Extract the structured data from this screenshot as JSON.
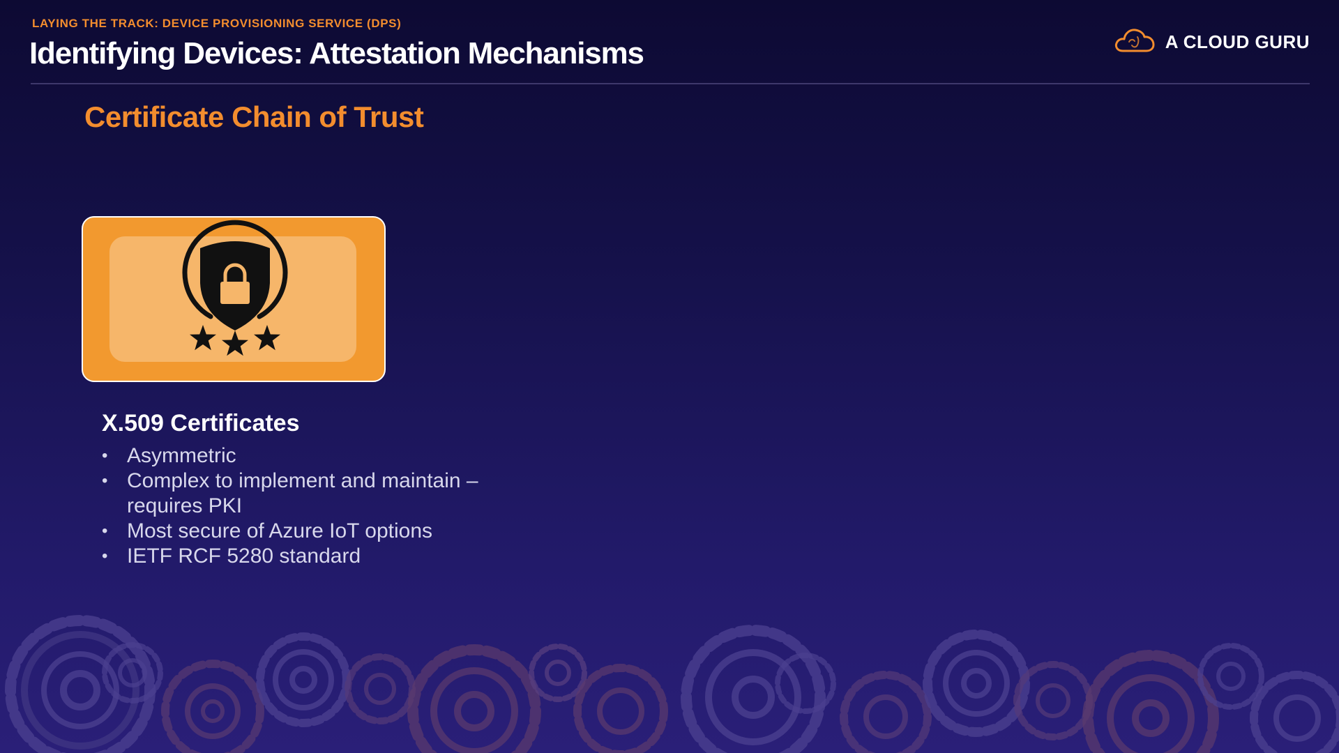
{
  "slide": {
    "eyebrow": "LAYING THE TRACK: DEVICE PROVISIONING SERVICE (DPS)",
    "title": "Identifying Devices: Attestation Mechanisms"
  },
  "brand": {
    "name": "A CLOUD GURU",
    "icon": "cloud-icon"
  },
  "section": {
    "title": "Certificate Chain of Trust"
  },
  "card": {
    "icon": "shield-lock-stars-icon"
  },
  "content": {
    "heading": "X.509 Certificates",
    "bullets": [
      "Asymmetric",
      "Complex to implement and maintain – requires PKI",
      "Most secure of Azure IoT options",
      "IETF RCF 5280 standard"
    ]
  },
  "colors": {
    "accent": "#f38d2e",
    "card": "#f2992f",
    "card_inner": "#f6b66a",
    "background_top": "#0d0a33",
    "background_bottom": "#2a1f78"
  }
}
